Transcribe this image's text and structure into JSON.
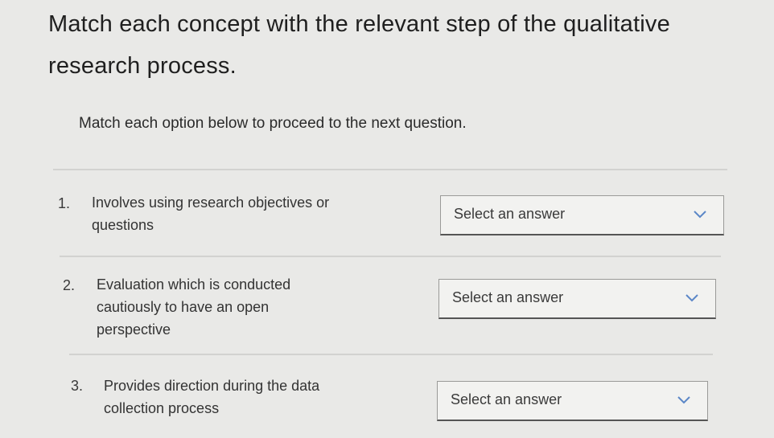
{
  "header": {
    "title": "Match each concept with the relevant step of the qualitative research process.",
    "instruction": "Match each option below to proceed to the next question."
  },
  "questions": [
    {
      "number": "1.",
      "text": "Involves using research objectives or questions",
      "select_label": "Select an answer"
    },
    {
      "number": "2.",
      "text": "Evaluation which is conducted cautiously to have an open perspective",
      "select_label": "Select an answer"
    },
    {
      "number": "3.",
      "text": "Provides direction during the data collection process",
      "select_label": "Select an answer"
    }
  ],
  "icons": {
    "dropdown": "chevron-down-icon"
  },
  "colors": {
    "background": "#e9e9e7",
    "select_background": "#f2f2f0",
    "chevron": "#5b87c7"
  }
}
